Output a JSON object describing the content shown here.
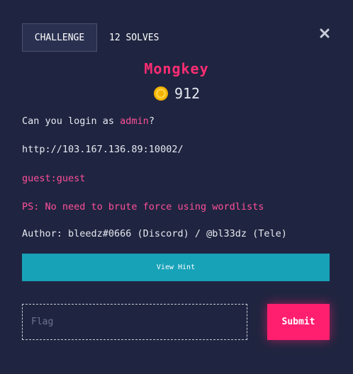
{
  "tabs": {
    "challenge_label": "CHALLENGE",
    "solves_label": "12 SOLVES"
  },
  "challenge": {
    "name": "Mongkey",
    "value": "912",
    "description_prefix": "Can you login as ",
    "description_user": "admin",
    "description_suffix": "?",
    "url": "http://103.167.136.89:10002/",
    "credentials": "guest:guest",
    "note": "PS: No need to brute force using wordlists",
    "author": "Author: bleedz#0666 (Discord) / @bl33dz (Tele)"
  },
  "actions": {
    "hint_label": "View Hint",
    "flag_placeholder": "Flag",
    "submit_label": "Submit"
  },
  "icons": {
    "close": "close-icon",
    "coin": "coin-icon"
  },
  "colors": {
    "background": "#1f2540",
    "accent_pink": "#ff2d74",
    "hint_button": "#17a2b8",
    "submit_button": "#ff1f6e"
  }
}
